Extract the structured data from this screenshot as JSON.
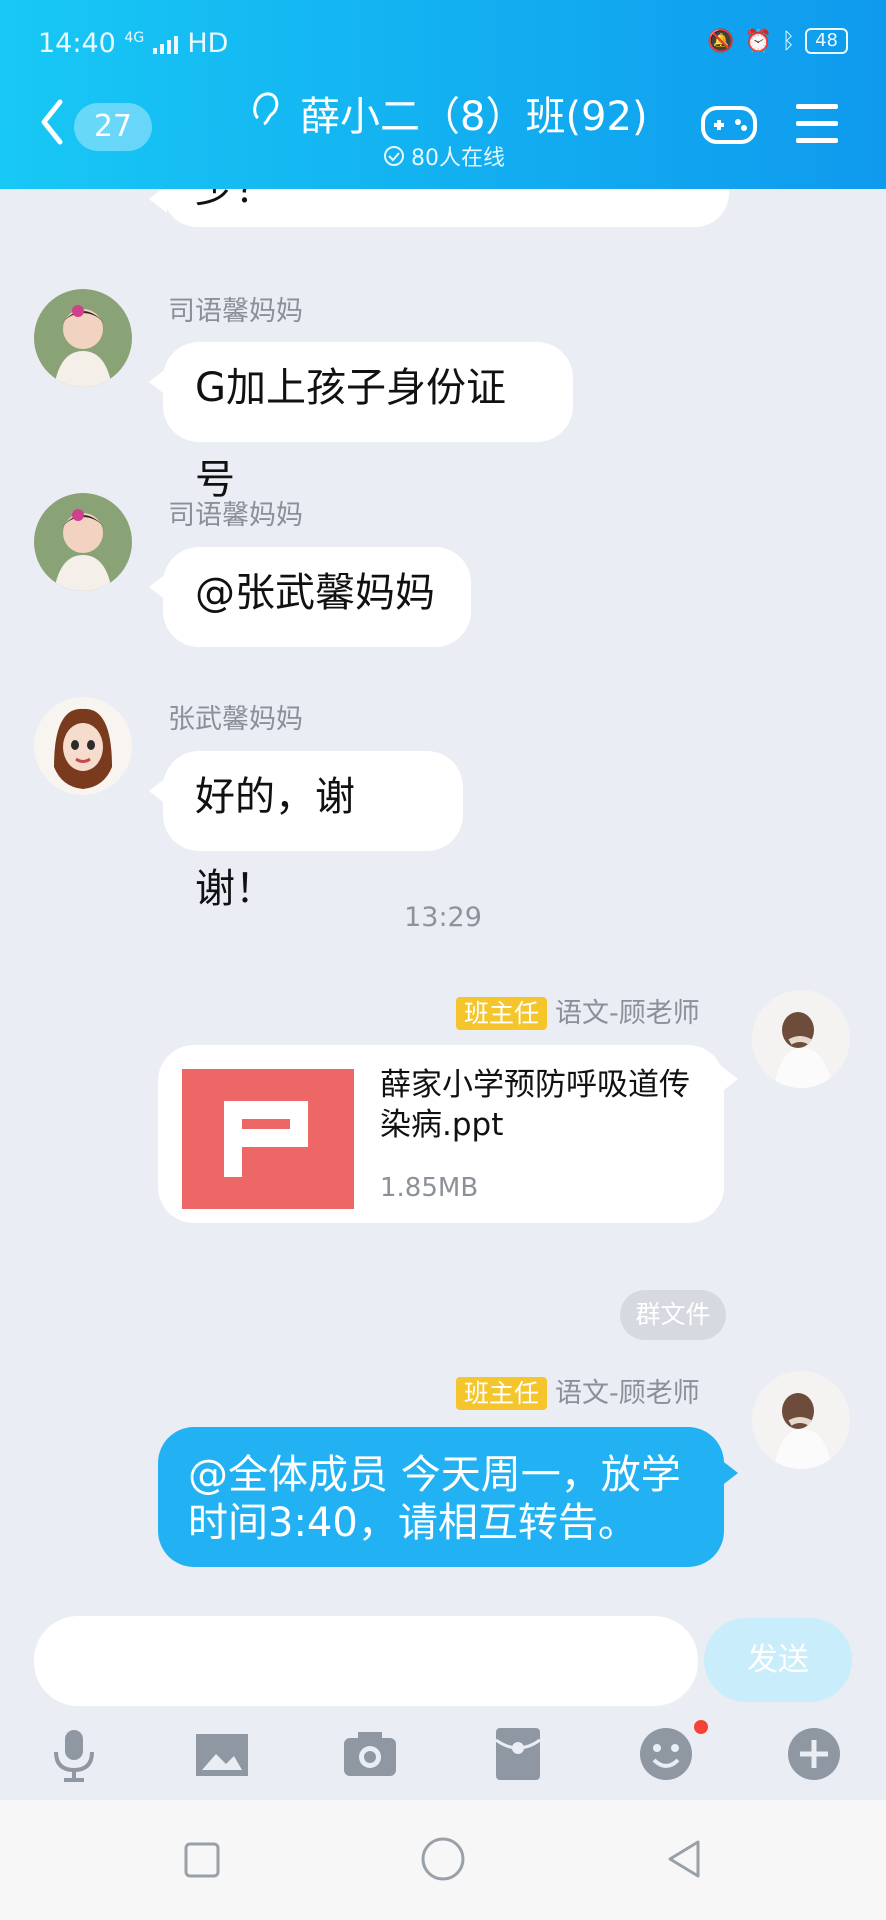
{
  "status": {
    "time": "14:40",
    "network": "4G",
    "hd": "HD",
    "battery": "48"
  },
  "header": {
    "unread_badge": "27",
    "title": "薛小二（8）班(92)",
    "online": "80人在线"
  },
  "messages": [
    {
      "sender": "",
      "text": "少？"
    },
    {
      "sender": "司语馨妈妈",
      "text": "G加上孩子身份证号"
    },
    {
      "sender": "司语馨妈妈",
      "text": "@张武馨妈妈"
    },
    {
      "sender": "张武馨妈妈",
      "text": "好的，谢谢！"
    }
  ],
  "timestamp": "13:29",
  "teacher": {
    "role": "班主任",
    "name": "语文-顾老师"
  },
  "file": {
    "name": "薛家小学预防呼吸道传染病.ppt",
    "size": "1.85MB",
    "tag": "群文件"
  },
  "announcement": "@全体成员 今天周一，放学时间3:40，请相互转告。",
  "composer": {
    "placeholder": "",
    "send_label": "发送"
  },
  "tools": [
    "mic-icon",
    "image-icon",
    "camera-icon",
    "red-packet-icon",
    "emoji-icon",
    "plus-icon"
  ],
  "colors": {
    "header_start": "#18c8f5",
    "header_end": "#0f9aee",
    "outgoing_bubble": "#22b2f3",
    "role_badge": "#f5c52c",
    "ppt_tile": "#ee6767",
    "send_button": "#c9edfa"
  }
}
